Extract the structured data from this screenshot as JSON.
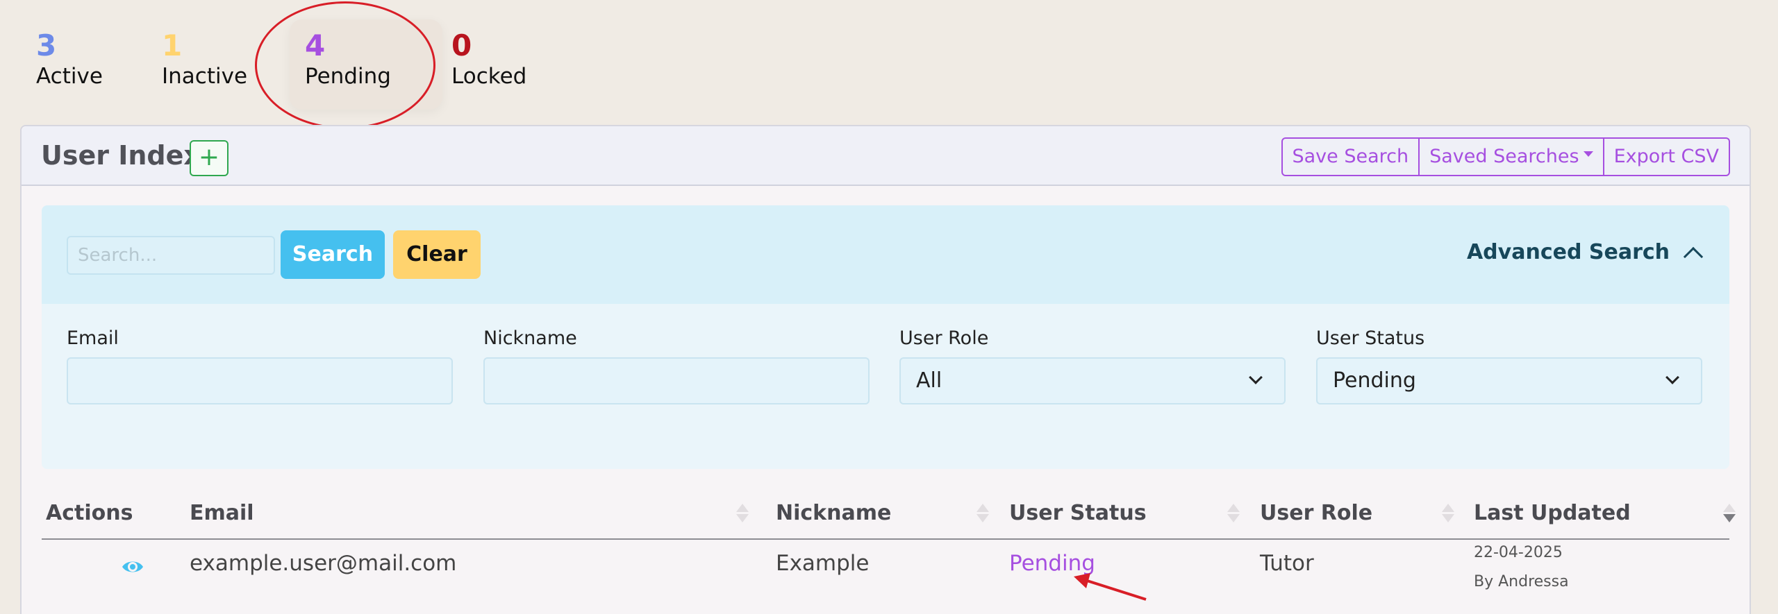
{
  "counters": [
    {
      "count": "3",
      "label": "Active",
      "color": "#6d8ae8"
    },
    {
      "count": "1",
      "label": "Inactive",
      "color": "#ffd36e"
    },
    {
      "count": "4",
      "label": "Pending",
      "color": "#a64fe0"
    },
    {
      "count": "0",
      "label": "Locked",
      "color": "#b8141e"
    }
  ],
  "header": {
    "title": "User Index",
    "add_label": "+",
    "save_search": "Save Search",
    "saved_searches": "Saved Searches",
    "export_csv": "Export CSV"
  },
  "search": {
    "placeholder": "Search...",
    "search_label": "Search",
    "clear_label": "Clear",
    "advanced_label": "Advanced Search"
  },
  "filters": {
    "email_label": "Email",
    "email_value": "",
    "nickname_label": "Nickname",
    "nickname_value": "",
    "role_label": "User Role",
    "role_value": "All",
    "status_label": "User Status",
    "status_value": "Pending"
  },
  "table": {
    "columns": [
      "Actions",
      "Email",
      "Nickname",
      "User Status",
      "User Role",
      "Last Updated"
    ],
    "rows": [
      {
        "email": "example.user@mail.com",
        "nickname": "Example",
        "status": "Pending",
        "role": "Tutor",
        "updated_date": "22-04-2025",
        "updated_by": "By Andressa"
      }
    ]
  },
  "colors": {
    "accent": "#a64fe0",
    "info": "#45c0ef",
    "warning": "#ffd36e",
    "success": "#2fa84f",
    "annotation": "#d81e27"
  },
  "icons": [
    "plus-icon",
    "caret-down-icon",
    "chevron-up-icon",
    "chevron-down-icon",
    "sort-icon",
    "eye-icon",
    "annotation-arrow"
  ]
}
